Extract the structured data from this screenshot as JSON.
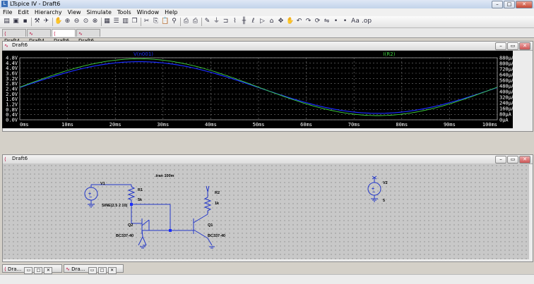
{
  "window": {
    "title": "LTspice IV - Draft6",
    "app_icon": "ltspice-logo-icon"
  },
  "menu": [
    "File",
    "Edit",
    "Hierarchy",
    "View",
    "Simulate",
    "Tools",
    "Window",
    "Help"
  ],
  "toolbar": {
    "icons": [
      "new-schematic-icon",
      "open-icon",
      "save-icon",
      "control-panel-icon",
      "run-icon",
      "halt-icon",
      "zoom-in-icon",
      "zoom-out-icon",
      "zoom-fit-icon",
      "zoom-cancel-icon",
      "autoscale-icon",
      "tile-horizontal-icon",
      "tile-vertical-icon",
      "cascade-icon",
      "cut-icon",
      "copy-icon",
      "paste-icon",
      "find-icon",
      "print-setup-icon",
      "print-icon",
      "wire-icon",
      "ground-icon",
      "label-net-icon",
      "resistor-icon",
      "capacitor-icon",
      "inductor-icon",
      "diode-icon",
      "component-icon",
      "move-icon",
      "drag-icon",
      "undo-icon",
      "redo-icon",
      "rotate-icon",
      "mirror-icon",
      "text-icon",
      "spice-directive-icon"
    ],
    "text_labels": {
      "text": "Aa",
      "directive": ".op"
    }
  },
  "tabs": [
    {
      "label": "Draft4",
      "kind": "schematic"
    },
    {
      "label": "Draft4",
      "kind": "waveform"
    },
    {
      "label": "Draft6",
      "kind": "schematic",
      "active": true
    },
    {
      "label": "Draft6",
      "kind": "waveform"
    }
  ],
  "waveform_panel": {
    "title": "Draft6",
    "buttons": [
      "minimize",
      "restore",
      "close"
    ]
  },
  "chart_data": {
    "type": "line",
    "title": "",
    "x": {
      "ticks": [
        "0ms",
        "10ms",
        "20ms",
        "30ms",
        "40ms",
        "50ms",
        "60ms",
        "70ms",
        "80ms",
        "90ms",
        "100ms"
      ],
      "range": [
        0,
        100
      ],
      "unit": "ms"
    },
    "y_left": {
      "ticks": [
        "4.8V",
        "4.4V",
        "4.0V",
        "3.6V",
        "3.2V",
        "2.8V",
        "2.4V",
        "2.0V",
        "1.6V",
        "1.2V",
        "0.8V",
        "0.4V",
        "0.0V"
      ],
      "range": [
        0,
        4.8
      ]
    },
    "y_right": {
      "ticks": [
        "880µA",
        "800µA",
        "720µA",
        "640µA",
        "560µA",
        "480µA",
        "400µA",
        "320µA",
        "240µA",
        "160µA",
        "80µA",
        "0µA"
      ],
      "range": [
        0,
        880
      ]
    },
    "grid": true,
    "series": [
      {
        "name": "V(n001)",
        "color": "#1a2cff",
        "axis": "left",
        "offset": 2.5,
        "amplitude": 2,
        "freq_hz": 10
      },
      {
        "name": "I(R2)",
        "color": "#3fd43f",
        "axis": "right",
        "offset": 463,
        "amplitude": 403,
        "freq_hz": 10
      }
    ]
  },
  "schematic_panel": {
    "title": "Draft6",
    "buttons": [
      "minimize",
      "restore",
      "close"
    ]
  },
  "schematic": {
    "directive": ".tran 100m",
    "v1": {
      "name": "V1",
      "value": "SINE(2.5 2 10)"
    },
    "r1": {
      "name": "R1",
      "value": "5k"
    },
    "r2": {
      "name": "R2",
      "value": "1k"
    },
    "q1": {
      "name": "Q1",
      "model": "BC337-40"
    },
    "q2": {
      "name": "Q2",
      "model": "BC337-40"
    },
    "v2": {
      "name": "V2",
      "value": "5"
    },
    "line_color": "#2438c8",
    "junction_color": "#1a2cff"
  },
  "taskbar": [
    {
      "label": "Dra...",
      "kind": "schematic"
    },
    {
      "label": "Dra...",
      "kind": "waveform"
    }
  ]
}
